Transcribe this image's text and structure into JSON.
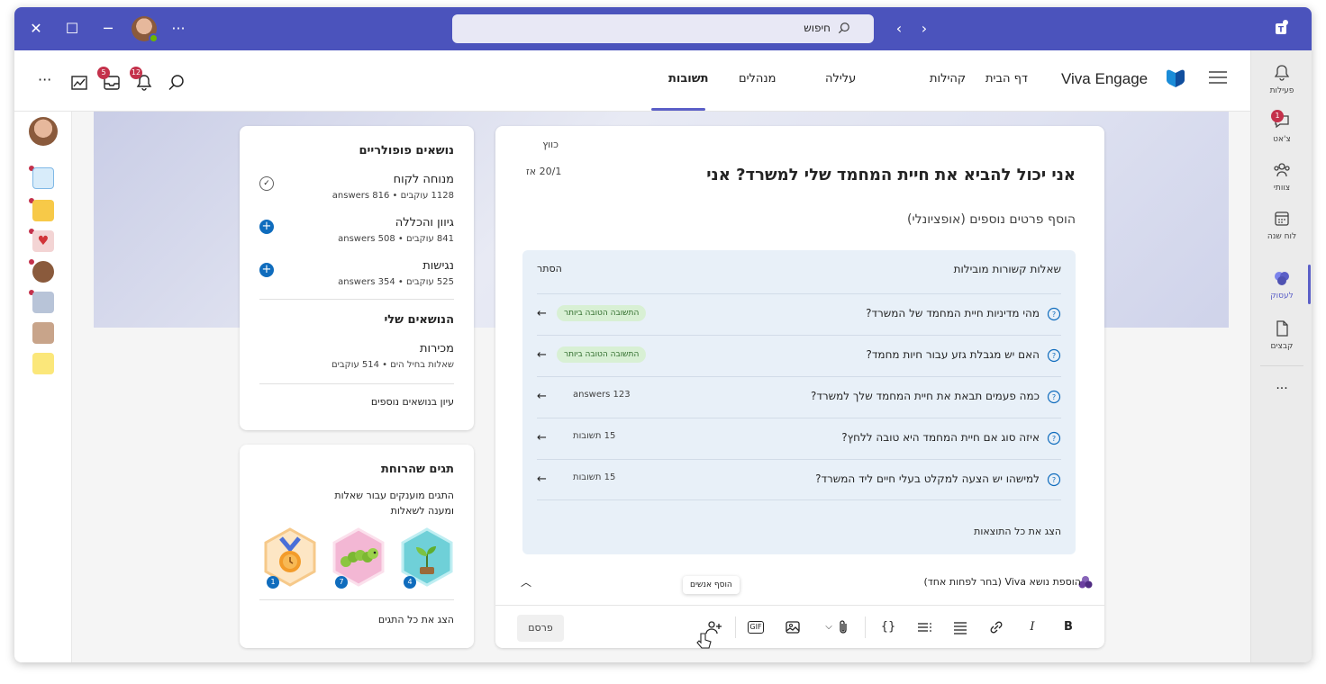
{
  "titlebar": {
    "search_placeholder": "חיפוש",
    "more_label": "···"
  },
  "rail": {
    "items": [
      {
        "label": "פעילות"
      },
      {
        "label": "צ'אט",
        "badge": "1"
      },
      {
        "label": "צוותי"
      },
      {
        "label": "לוח שנה"
      },
      {
        "label": "לעסוק"
      },
      {
        "label": "קבצים"
      }
    ],
    "more_label": "···"
  },
  "appbar": {
    "brand": "Viva Engage",
    "nav": [
      "דף הבית",
      "קהילות",
      "עלילה",
      "מנהלים",
      "תשובות"
    ],
    "bell_badge": "12",
    "inbox_badge": "5"
  },
  "question": {
    "community": "כווץ",
    "char_count": "20/1 אז",
    "title": "אני יכול להביא את חיית המחמד שלי למשרד? אני",
    "details_placeholder": "הוסף פרטים נוספים (אופציונלי)",
    "related": {
      "header": "שאלות קשורות מובילות",
      "hide": "הסתר",
      "items": [
        {
          "q": "מהי מדיניות חיית המחמד של המשרד?",
          "tag": "התשובה הטובה ביותר"
        },
        {
          "q": "האם יש מגבלת גזע עבור חיות מחמד?",
          "tag": "התשובה הטובה ביותר"
        },
        {
          "q": "כמה פעמים תבאת את חיית המחמד שלך למשרד?",
          "meta": "123 answers"
        },
        {
          "q": "איזה סוג אם חיית המחמד היא טובה ללחץ?",
          "meta": "15 תשובות"
        },
        {
          "q": "למישהו יש הצעה למקלט בעלי חיים ליד המשרד?",
          "meta": "15 תשובות"
        }
      ],
      "show_all": "הצג את כל התוצאות"
    },
    "topic_prompt": "הוספת נושא Viva (בחר לפחות אחד)",
    "tooltip": "הוסף אנשים",
    "publish": "פרסם",
    "toolbar": {
      "bold": "B",
      "italic": "I",
      "code": "{}",
      "gif": "GIF"
    }
  },
  "popular": {
    "title": "נושאים פופולריים",
    "topics": [
      {
        "name": "מנוחה לקוח",
        "sub": "1128 עוקבים • 816 answers"
      },
      {
        "name": "גיוון והכללה",
        "sub": "841 עוקבים • 508 answers"
      },
      {
        "name": "נגישות",
        "sub": "525 עוקבים • 354 answers"
      }
    ],
    "my_topics_title": "הנושאים שלי",
    "my_topic": {
      "name": "מכירות",
      "sub": "שאלות בחיל הים • 514 עוקבים"
    },
    "browse_more": "עיון בנושאים נוספים"
  },
  "badges": {
    "title": "תגים שהרוחת",
    "desc": "התגים מוענקים עבור שאלות ומענה לשאלות",
    "items": [
      {
        "icon": "sprout-icon",
        "count": "4",
        "color": "#6fd0d8"
      },
      {
        "icon": "caterpillar-icon",
        "count": "7",
        "color": "#f3b7d4"
      },
      {
        "icon": "medal-icon",
        "count": "1",
        "color": "#f6c98a"
      }
    ],
    "show_all": "הצג את כל התגים"
  },
  "colors": {
    "accent": "#5b5fc7",
    "titlebar": "#4b53bc",
    "badge": "#c4314b",
    "follow": "#0f6cbd"
  }
}
